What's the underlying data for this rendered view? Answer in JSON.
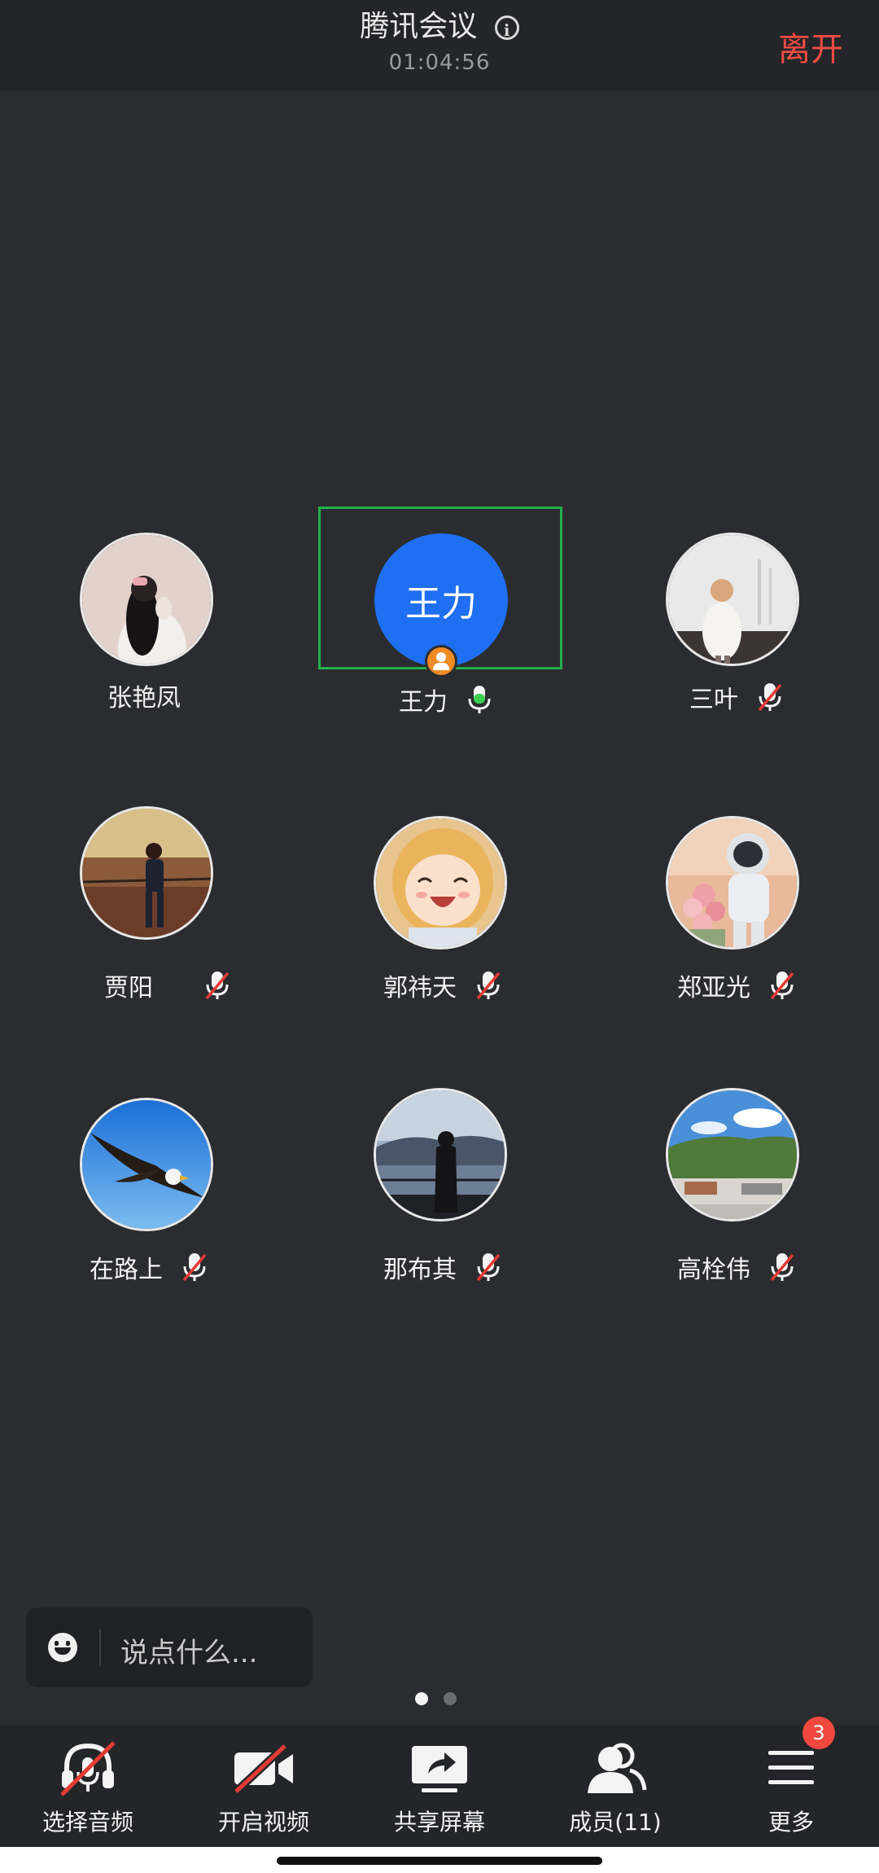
{
  "header": {
    "title": "腾讯会议",
    "timer": "01:04:56",
    "leave_label": "离开"
  },
  "participants": [
    {
      "name": "张艳凤",
      "mic": "none",
      "avatar": "photo-girl-white"
    },
    {
      "name": "王力",
      "mic": "on",
      "avatar_text": "王力",
      "host": true,
      "speaking": true
    },
    {
      "name": "三叶",
      "mic": "muted",
      "avatar": "photo-girl-back"
    },
    {
      "name": "贾阳",
      "mic": "muted",
      "avatar": "photo-man-canyon"
    },
    {
      "name": "郭祎天",
      "mic": "muted",
      "avatar": "anime-girl-smiling"
    },
    {
      "name": "郑亚光",
      "mic": "muted",
      "avatar": "astronaut-flowers"
    },
    {
      "name": "在路上",
      "mic": "muted",
      "avatar": "eagle-sky"
    },
    {
      "name": "那布其",
      "mic": "muted",
      "avatar": "woman-silhouette-lake"
    },
    {
      "name": "高栓伟",
      "mic": "muted",
      "avatar": "landscape-hills"
    }
  ],
  "chat": {
    "placeholder": "说点什么..."
  },
  "pager": {
    "pages": 2,
    "current": 1
  },
  "toolbar": {
    "audio_label": "选择音频",
    "video_label": "开启视频",
    "share_label": "共享屏幕",
    "members_label": "成员(11)",
    "more_label": "更多",
    "more_badge": "3"
  },
  "colors": {
    "background": "#2b2c2f",
    "leave": "#f24b44",
    "active_border": "#22b14c",
    "mic_active": "#3ccf4e",
    "mute_slash": "#e43a35",
    "avatar_blue": "#1f6ff2"
  }
}
